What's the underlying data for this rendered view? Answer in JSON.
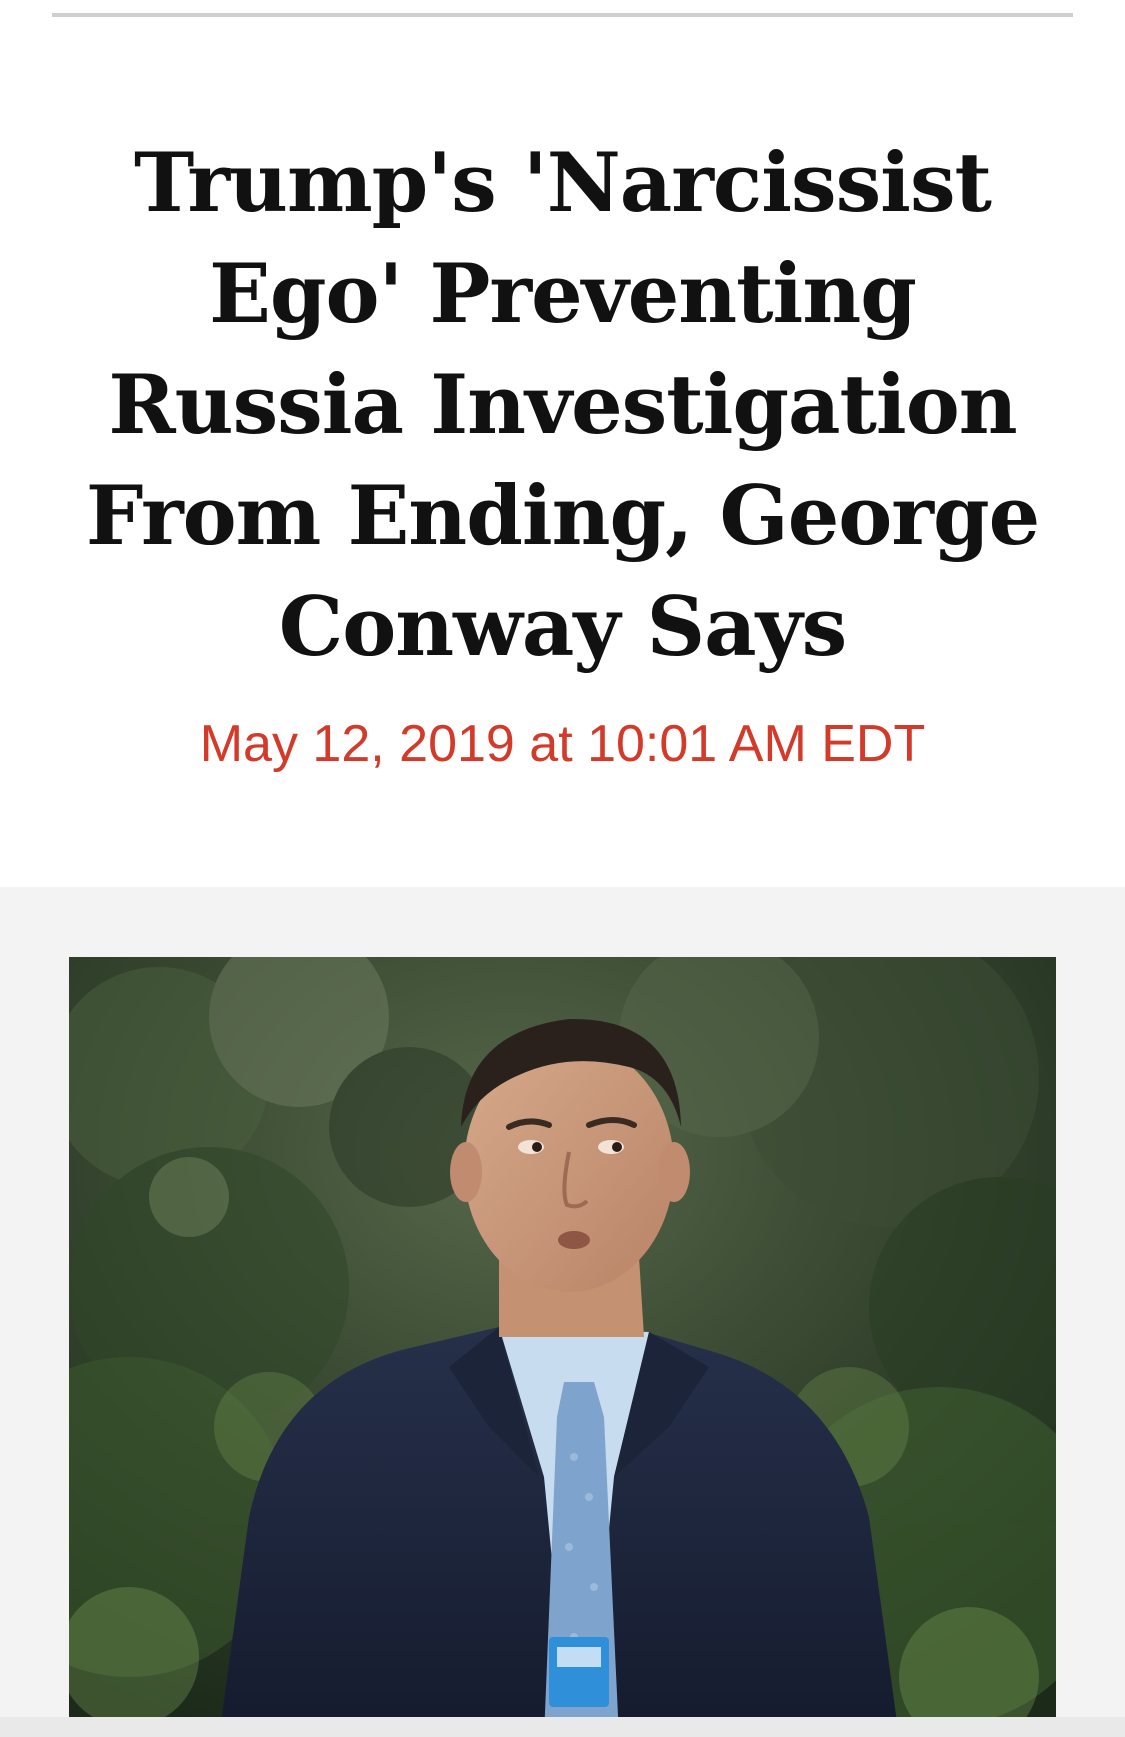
{
  "article": {
    "headline": "Trump's 'Narcissist Ego' Preventing Russia Investigation From Ending, George Conway Says",
    "timestamp": "May 12, 2019 at 10:01 AM EDT"
  },
  "image": {
    "subject": "george-conway-photo"
  },
  "colors": {
    "timestamp": "#d43a2a",
    "headline": "#111111",
    "media_background": "#f3f3f3",
    "rule": "#cfcfcf"
  }
}
